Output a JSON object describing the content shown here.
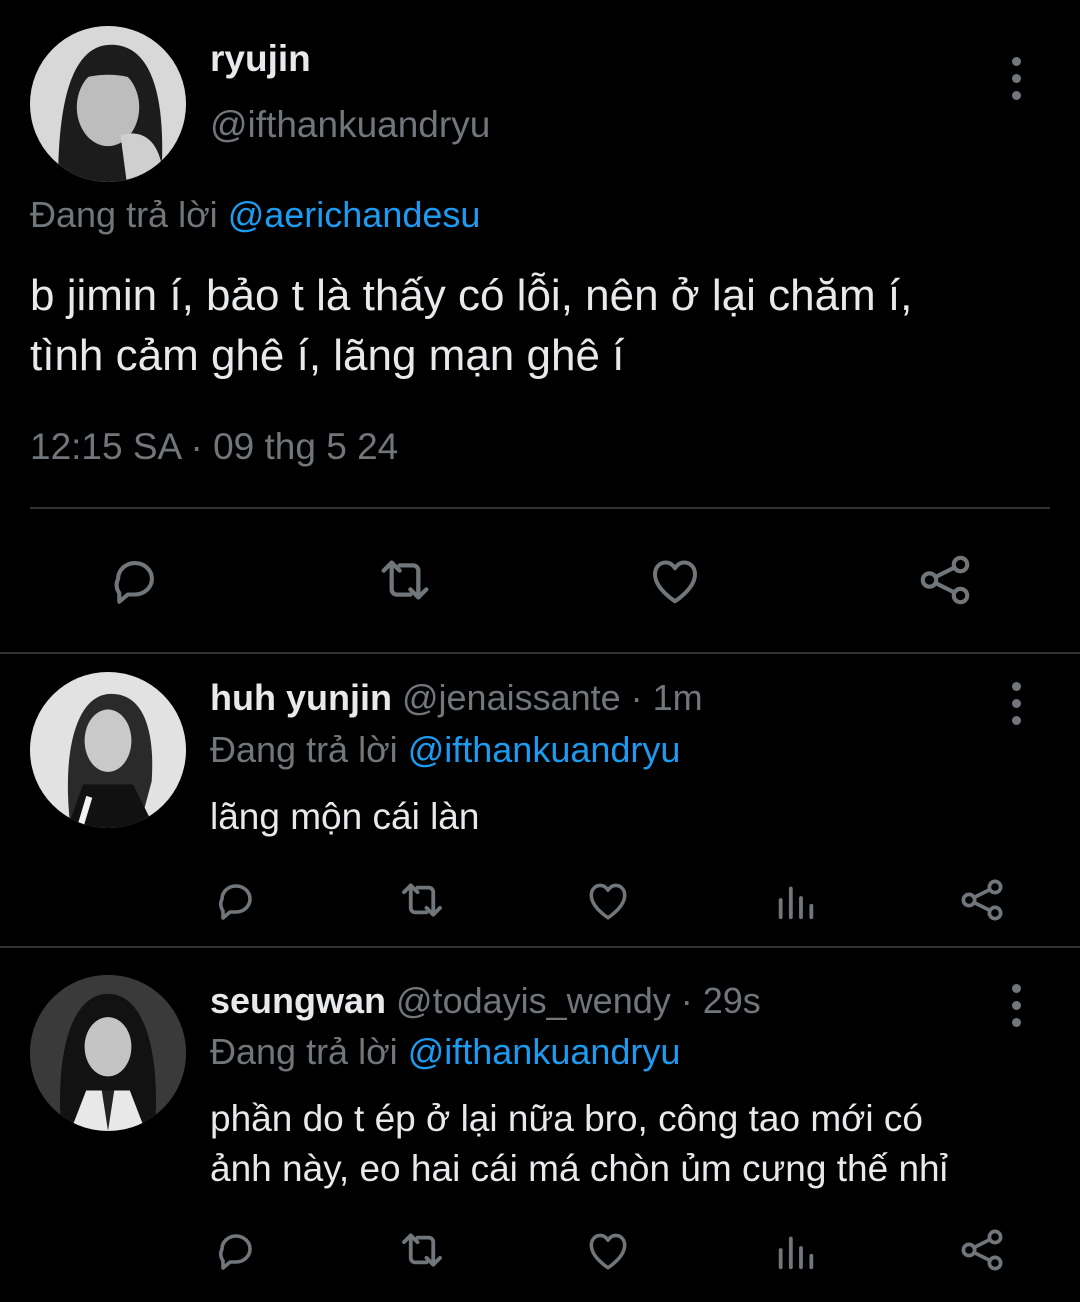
{
  "main_tweet": {
    "display_name": "ryujin",
    "handle": "@ifthankuandryu",
    "replying_label": "Đang trả lời",
    "replying_to": "@aerichandesu",
    "text_line1": "b jimin í, bảo t là thấy có lỗi, nên ở lại chăm í,",
    "text_line2": "tình cảm ghê í, lãng mạn ghê í",
    "timestamp": "12:15 SA · 09 thg 5 24"
  },
  "replies": [
    {
      "display_name": "huh yunjin",
      "handle": "@jenaissante",
      "time": "· 1m",
      "replying_label": "Đang trả lời",
      "replying_to": "@ifthankuandryu",
      "text_line1": "lãng mộn cái làn",
      "text_line2": ""
    },
    {
      "display_name": "seungwan",
      "handle": "@todayis_wendy",
      "time": "· 29s",
      "replying_label": "Đang trả lời",
      "replying_to": "@ifthankuandryu",
      "text_line1": "phần do t ép ở lại nữa bro, công tao mới có",
      "text_line2": "ảnh này, eo hai cái má chòn ủm cưng thế nhỉ"
    }
  ],
  "icons": {
    "main_actions": [
      "reply-icon",
      "retweet-icon",
      "like-icon",
      "share-icon"
    ],
    "reply_actions": [
      "reply-icon",
      "retweet-icon",
      "like-icon",
      "analytics-icon",
      "share-icon"
    ],
    "menu": "more-vertical-icon"
  },
  "colors": {
    "background": "#000000",
    "text": "#e7e9ea",
    "muted": "#71767b",
    "link": "#1d9bf0",
    "divider": "#2f3336"
  }
}
